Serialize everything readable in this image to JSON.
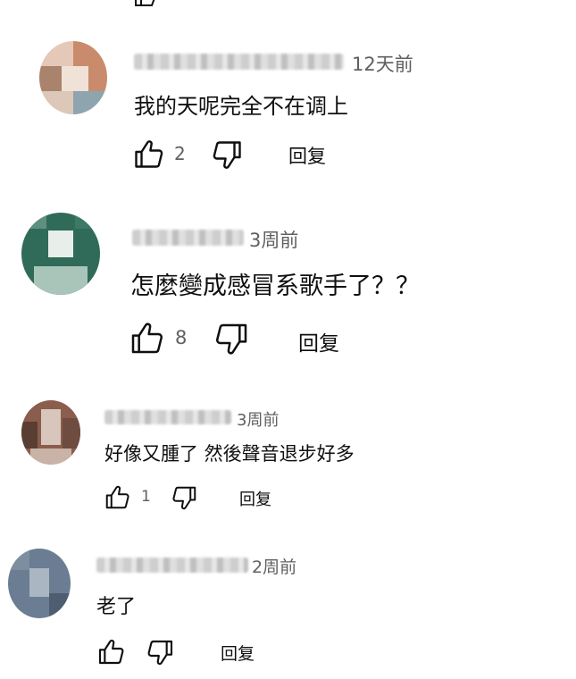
{
  "comments": [
    {
      "time": "12天前",
      "text": "我的天呢完全不在调上",
      "like_count": "2",
      "reply_label": "回复",
      "avatar_colors": [
        "#e6c8b8",
        "#c98b6b",
        "#f0e2d6",
        "#a9836c",
        "#dcc7b8",
        "#8ea5b0"
      ]
    },
    {
      "time": "3周前",
      "text": "怎麼變成感冒系歌手了？？",
      "like_count": "8",
      "reply_label": "回复",
      "avatar_colors": [
        "#2f6b58",
        "#1f5a47",
        "#e8eee9",
        "#5f8f7e",
        "#a9c4b9",
        "#3d7a66"
      ]
    },
    {
      "time": "3周前",
      "text": "好像又腫了 然後聲音退步好多",
      "like_count": "1",
      "reply_label": "回复",
      "avatar_colors": [
        "#8a5d4c",
        "#5a3d33",
        "#d8c6bd",
        "#a47a66",
        "#c9b2a6",
        "#6e4c40"
      ]
    },
    {
      "time": "2周前",
      "text": "老了",
      "like_count": "",
      "reply_label": "回复",
      "avatar_colors": [
        "#6b7d92",
        "#55667a",
        "#9aa8b6",
        "#7d8ea1",
        "#aab6c2",
        "#4e5e70"
      ]
    }
  ]
}
